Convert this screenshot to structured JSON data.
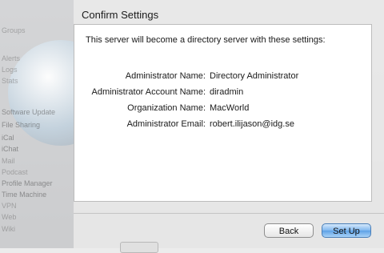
{
  "background": {
    "sidebar_items": [
      "Groups",
      "Alerts",
      "Logs",
      "Stats",
      "Software Update",
      "File Sharing",
      "iCal",
      "iChat",
      "Mail",
      "Podcast",
      "Profile Manager",
      "Time Machine",
      "VPN",
      "Web",
      "Wiki"
    ]
  },
  "sheet": {
    "title": "Confirm Settings",
    "intro": "This server will become a directory server with these settings:",
    "settings": [
      {
        "label": "Administrator Name:",
        "value": "Directory Administrator"
      },
      {
        "label": "Administrator Account Name:",
        "value": "diradmin"
      },
      {
        "label": "Organization Name:",
        "value": "MacWorld"
      },
      {
        "label": "Administrator Email:",
        "value": "robert.ilijason@idg.se"
      }
    ]
  },
  "buttons": {
    "back": "Back",
    "setup": "Set Up"
  },
  "colors": {
    "default_button": "#6aa9e8",
    "sheet_background": "#eaeaea"
  }
}
